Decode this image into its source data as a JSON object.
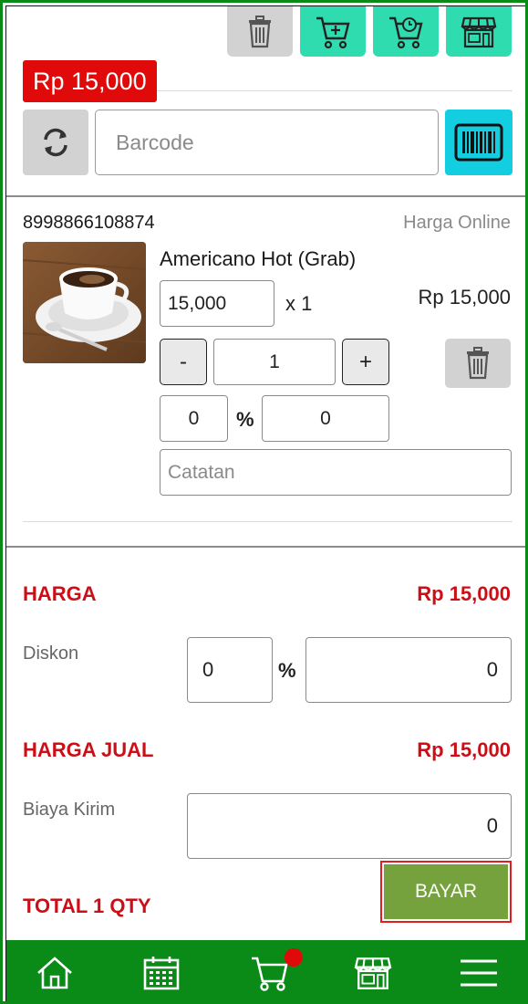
{
  "header": {
    "total_badge": "Rp 15,000",
    "toolbar_icons": [
      "trash-icon",
      "cart-add-icon",
      "cart-schedule-icon",
      "store-icon"
    ]
  },
  "search": {
    "barcode_placeholder": "Barcode",
    "refresh_icon": "refresh-icon",
    "scan_icon": "barcode-scan-icon"
  },
  "cart_item": {
    "sku": "8998866108874",
    "price_type": "Harga Online",
    "name": "Americano Hot (Grab)",
    "unit_price": "15,000",
    "times_label": "x 1",
    "line_total": "Rp 15,000",
    "minus_label": "-",
    "plus_label": "+",
    "qty": "1",
    "discount_pct": "0",
    "pct_sign": "%",
    "discount_amount": "0",
    "note_placeholder": "Catatan"
  },
  "summary": {
    "harga_label": "HARGA",
    "harga_value": "Rp 15,000",
    "diskon_label": "Diskon",
    "diskon_pct": "0",
    "pct_sign": "%",
    "diskon_amount": "0",
    "harga_jual_label": "HARGA JUAL",
    "harga_jual_value": "Rp 15,000",
    "biaya_kirim_label": "Biaya Kirim",
    "biaya_kirim_value": "0",
    "total_label": "TOTAL 1 QTY",
    "pay_button": "BAYAR"
  },
  "bottom_nav": {
    "items": [
      "home-icon",
      "calendar-icon",
      "cart-icon",
      "store-icon",
      "menu-icon"
    ]
  },
  "colors": {
    "brand_green": "#0a8a17",
    "accent_red": "#e00a0a",
    "teal": "#2fdcb0",
    "cyan": "#13cde0",
    "pay_green": "#76a23e",
    "label_red": "#cc0f17"
  }
}
